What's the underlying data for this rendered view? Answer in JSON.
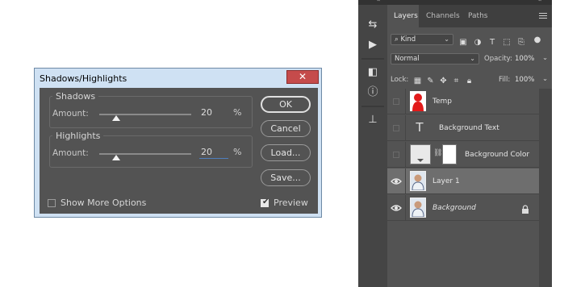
{
  "dialog": {
    "title": "Shadows/Highlights",
    "close_glyph": "✕",
    "shadows": {
      "group_title": "Shadows",
      "amount_label": "Amount:",
      "amount": "20",
      "unit": "%"
    },
    "highlights": {
      "group_title": "Highlights",
      "amount_label": "Amount:",
      "amount": "20",
      "unit": "%"
    },
    "buttons": {
      "ok": "OK",
      "cancel": "Cancel",
      "load": "Load...",
      "save": "Save..."
    },
    "show_more_options": {
      "label": "Show More Options",
      "checked": false
    },
    "preview": {
      "label": "Preview",
      "checked": true
    }
  },
  "photoshop": {
    "collapse_glyph": "«",
    "tools": [
      {
        "name": "history-icon",
        "glyph": "⇆"
      },
      {
        "name": "play-icon",
        "glyph": "▶"
      },
      {
        "name": "adjust-icon",
        "glyph": "◧"
      },
      {
        "name": "info-icon",
        "glyph": "ⓘ"
      },
      {
        "name": "clone-source-icon",
        "glyph": "⊥"
      }
    ],
    "tabs": [
      "Layers",
      "Channels",
      "Paths"
    ],
    "active_tab": "Layers",
    "filter": {
      "kind": "Kind",
      "search_glyph": "⌕"
    },
    "blend_mode": "Normal",
    "opacity_label": "Opacity:",
    "opacity": "100%",
    "lock_label": "Lock:",
    "fill_label": "Fill:",
    "fill": "100%",
    "layers": [
      {
        "name": "Temp",
        "visible": false,
        "italic": false,
        "thumb": "red-shape"
      },
      {
        "name": "Background Text",
        "visible": false,
        "italic": false,
        "thumb": "text"
      },
      {
        "name": "Background Color",
        "visible": false,
        "italic": false,
        "thumb": "fill-mask"
      },
      {
        "name": "Layer 1",
        "visible": true,
        "italic": false,
        "selected": true,
        "thumb": "photo"
      },
      {
        "name": "Background",
        "visible": true,
        "italic": true,
        "locked": true,
        "thumb": "photo"
      }
    ],
    "colors": {
      "panel": "#535353",
      "selected_row": "#6e6e6e",
      "temp_red": "#e21a1a"
    }
  }
}
